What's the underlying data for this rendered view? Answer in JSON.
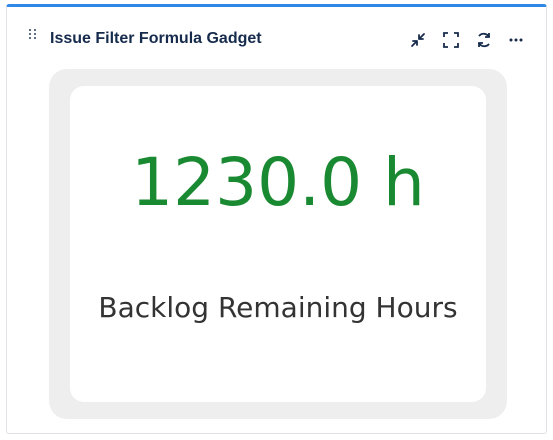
{
  "gadget": {
    "title": "Issue Filter Formula Gadget",
    "accent_color": "#2f87e6",
    "actions": [
      {
        "name": "minimize",
        "icon": "collapse-arrows-icon"
      },
      {
        "name": "fullscreen",
        "icon": "fullscreen-icon"
      },
      {
        "name": "refresh",
        "icon": "refresh-icon"
      },
      {
        "name": "more",
        "icon": "more-horizontal-icon"
      }
    ]
  },
  "metric": {
    "value": "1230.0 h",
    "label": "Backlog Remaining Hours",
    "value_color": "#1a8a32"
  }
}
